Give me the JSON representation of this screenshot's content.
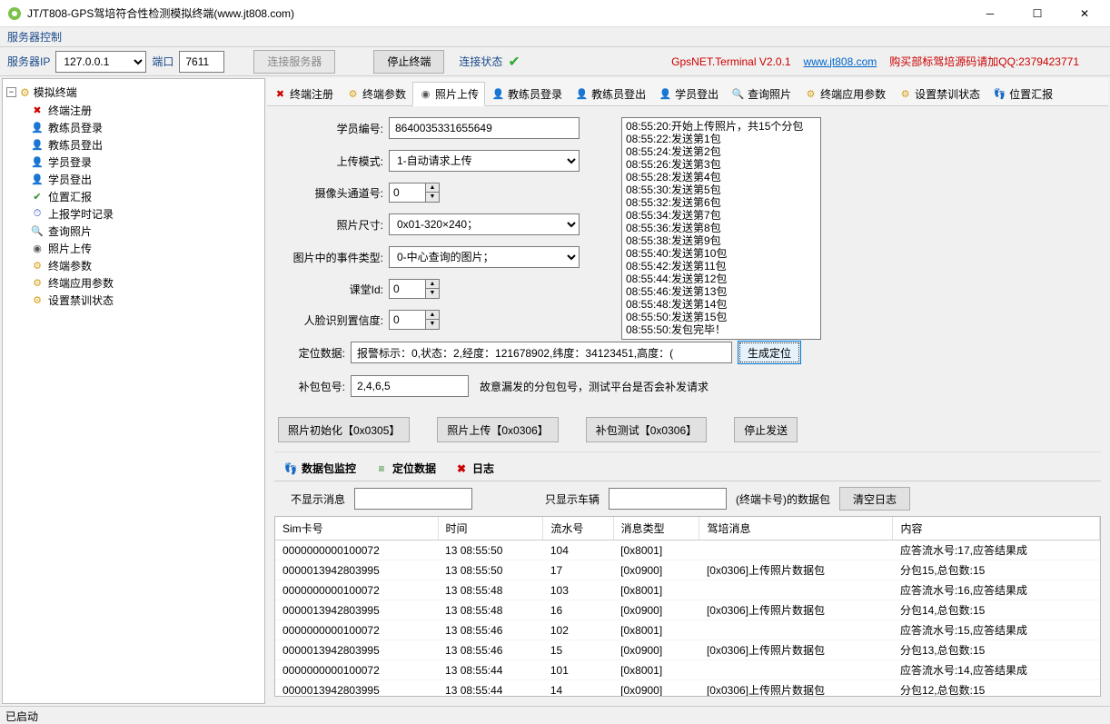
{
  "window": {
    "title": "JT/T808-GPS驾培符合性检测模拟终端(www.jt808.com)"
  },
  "menubar": {
    "server_control": "服务器控制"
  },
  "toolbar": {
    "server_ip_label": "服务器IP",
    "server_ip": "127.0.0.1",
    "port_label": "端口",
    "port": "7611",
    "connect": "连接服务器",
    "stop": "停止终端",
    "status_label": "连接状态",
    "brand": "GpsNET.Terminal V2.0.1",
    "link": "www.jt808.com",
    "promo": "购买部标驾培源码请加QQ:2379423771"
  },
  "tree": {
    "root": "模拟终端",
    "items": [
      "终端注册",
      "教练员登录",
      "教练员登出",
      "学员登录",
      "学员登出",
      "位置汇报",
      "上报学时记录",
      "查询照片",
      "照片上传",
      "终端参数",
      "终端应用参数",
      "设置禁训状态"
    ]
  },
  "tabs": [
    "终端注册",
    "终端参数",
    "照片上传",
    "教练员登录",
    "教练员登出",
    "学员登出",
    "查询照片",
    "终端应用参数",
    "设置禁训状态",
    "位置汇报"
  ],
  "active_tab": "照片上传",
  "form": {
    "student_no_label": "学员编号:",
    "student_no": "8640035331655649",
    "upload_mode_label": "上传模式:",
    "upload_mode": "1-自动请求上传",
    "camera_ch_label": "摄像头通道号:",
    "camera_ch": "0",
    "size_label": "照片尺寸:",
    "size": "0x01-320×240；",
    "event_label": "图片中的事件类型:",
    "event": "0-中心查询的图片；",
    "lesson_label": "课堂Id:",
    "lesson": "0",
    "face_label": "人脸识别置信度:",
    "face": "0",
    "pos_label": "定位数据:",
    "pos": "报警标示：0,状态：2,经度：121678902,纬度：34123451,高度：(",
    "gen_pos": "生成定位",
    "resend_label": "补包包号:",
    "resend": "2,4,6,5",
    "resend_hint": "故意漏发的分包包号，测试平台是否会补发请求"
  },
  "log": [
    "08:55:20:开始上传照片，共15个分包",
    "08:55:22:发送第1包",
    "08:55:24:发送第2包",
    "08:55:26:发送第3包",
    "08:55:28:发送第4包",
    "08:55:30:发送第5包",
    "08:55:32:发送第6包",
    "08:55:34:发送第7包",
    "08:55:36:发送第8包",
    "08:55:38:发送第9包",
    "08:55:40:发送第10包",
    "08:55:42:发送第11包",
    "08:55:44:发送第12包",
    "08:55:46:发送第13包",
    "08:55:48:发送第14包",
    "08:55:50:发送第15包",
    "08:55:50:发包完毕！"
  ],
  "buttons": {
    "init": "照片初始化【0x0305】",
    "upload": "照片上传【0x0306】",
    "retest": "补包测试【0x0306】",
    "stop": "停止发送"
  },
  "bottom": {
    "tabs": [
      "数据包监控",
      "定位数据",
      "日志"
    ],
    "filter_hide": "不显示消息",
    "filter_veh": "只显示车辆",
    "filter_suffix": "(终端卡号)的数据包",
    "clear": "清空日志",
    "columns": [
      "Sim卡号",
      "时间",
      "流水号",
      "消息类型",
      "驾培消息",
      "内容"
    ],
    "rows": [
      [
        "0000000000100072",
        "13 08:55:50",
        "104",
        "[0x8001]",
        "",
        "应答流水号:17,应答结果成"
      ],
      [
        "0000013942803995",
        "13 08:55:50",
        "17",
        "[0x0900]",
        "[0x0306]上传照片数据包",
        "分包15,总包数:15"
      ],
      [
        "0000000000100072",
        "13 08:55:48",
        "103",
        "[0x8001]",
        "",
        "应答流水号:16,应答结果成"
      ],
      [
        "0000013942803995",
        "13 08:55:48",
        "16",
        "[0x0900]",
        "[0x0306]上传照片数据包",
        "分包14,总包数:15"
      ],
      [
        "0000000000100072",
        "13 08:55:46",
        "102",
        "[0x8001]",
        "",
        "应答流水号:15,应答结果成"
      ],
      [
        "0000013942803995",
        "13 08:55:46",
        "15",
        "[0x0900]",
        "[0x0306]上传照片数据包",
        "分包13,总包数:15"
      ],
      [
        "0000000000100072",
        "13 08:55:44",
        "101",
        "[0x8001]",
        "",
        "应答流水号:14,应答结果成"
      ],
      [
        "0000013942803995",
        "13 08:55:44",
        "14",
        "[0x0900]",
        "[0x0306]上传照片数据包",
        "分包12,总包数:15"
      ]
    ]
  },
  "status": "已启动",
  "tree_icons": [
    "✖",
    "👤",
    "👤",
    "👤",
    "👤",
    "✔",
    "⏱",
    "🔍",
    "◉",
    "⚙",
    "⚙",
    "⚙"
  ],
  "tree_icon_cls": [
    "red",
    "orange",
    "orange",
    "orange",
    "orange",
    "green",
    "blue",
    "blue",
    "camera",
    "gear",
    "gear",
    "gear"
  ],
  "tab_icons": [
    "✖",
    "⚙",
    "◉",
    "👤",
    "👤",
    "👤",
    "🔍",
    "⚙",
    "⚙",
    "👣"
  ],
  "tab_icon_cls": [
    "red",
    "gear",
    "camera",
    "orange",
    "orange",
    "orange",
    "blue",
    "gear",
    "gear",
    "blue"
  ],
  "btab_icons": [
    "👣",
    "≡",
    "✖"
  ],
  "btab_icon_cls": [
    "blue",
    "green",
    "red"
  ]
}
